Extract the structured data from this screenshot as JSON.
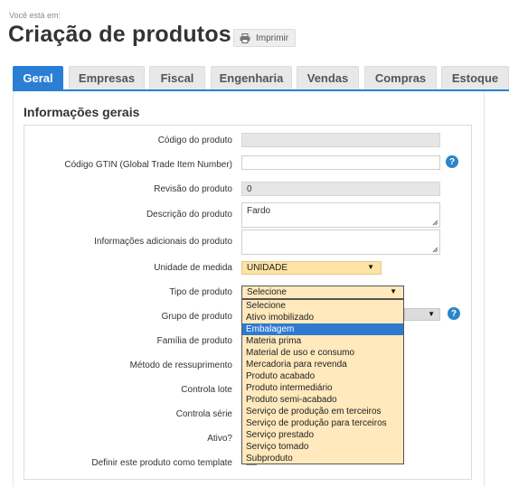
{
  "breadcrumb": "Você está em:",
  "title": "Criação de produtos",
  "print_label": "Imprimir",
  "tabs": [
    {
      "label": "Geral",
      "active": true
    },
    {
      "label": "Empresas"
    },
    {
      "label": "Fiscal"
    },
    {
      "label": "Engenharia"
    },
    {
      "label": "Vendas"
    },
    {
      "label": "Compras"
    },
    {
      "label": "Estoque"
    }
  ],
  "section_title": "Informações gerais",
  "form": {
    "codigo_label": "Código do produto",
    "codigo_value": "",
    "gtin_label": "Código GTIN (Global Trade Item Number)",
    "gtin_value": "",
    "revisao_label": "Revisão do produto",
    "revisao_value": "0",
    "descricao_label": "Descrição do produto",
    "descricao_value": "Fardo",
    "info_label": "Informações adicionais do produto",
    "info_value": "",
    "unidade_label": "Unidade de medida",
    "unidade_value": "UNIDADE",
    "tipo_label": "Tipo de produto",
    "tipo_value": "Selecione",
    "grupo_label": "Grupo de produto",
    "familia_label": "Família de produto",
    "metodo_label": "Método de ressuprimento",
    "lote_label": "Controla lote",
    "serie_label": "Controla série",
    "ativo_label": "Ativo?",
    "template_label": "Definir este produto como template"
  },
  "tipo_options": [
    "Selecione",
    "Ativo imobilizado",
    "Embalagem",
    "Materia prima",
    "Material de uso e consumo",
    "Mercadoria para revenda",
    "Produto acabado",
    "Produto intermediário",
    "Produto semi-acabado",
    "Serviço de produção em terceiros",
    "Serviço de produção para terceiros",
    "Serviço prestado",
    "Serviço tomado",
    "Subproduto"
  ],
  "tipo_highlighted": "Embalagem",
  "help_glyph": "?",
  "colors": {
    "accent": "#2a7fd4",
    "select_bg": "#ffe3a3",
    "highlight": "#2e7ad1"
  }
}
